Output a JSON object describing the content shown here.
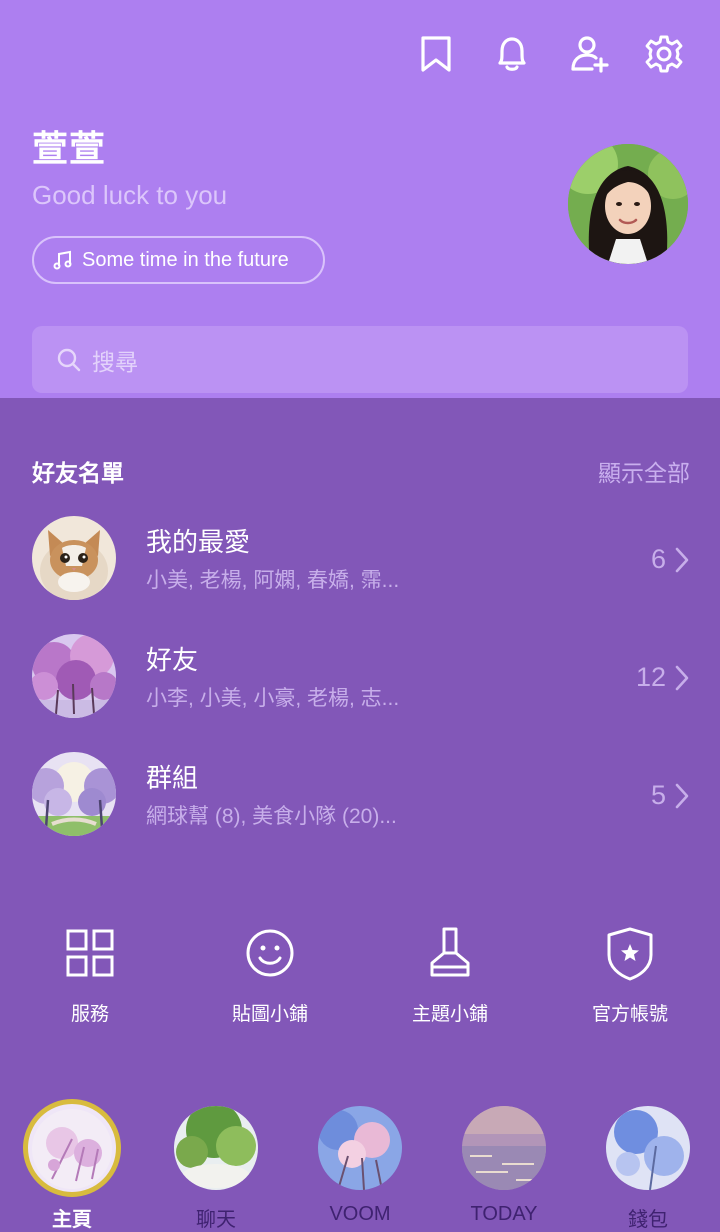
{
  "profile": {
    "name": "萱萱",
    "status": "Good luck to you",
    "music": "Some time in the future"
  },
  "topbar": {
    "icons": [
      "bookmark-icon",
      "bell-icon",
      "add-friend-icon",
      "settings-icon"
    ]
  },
  "search": {
    "placeholder": "搜尋"
  },
  "friends": {
    "title": "好友名單",
    "show_all": "顯示全部",
    "groups": [
      {
        "title": "我的最愛",
        "subtitle": "小美, 老楊, 阿嫻, 春嬌, 霈...",
        "count": "6"
      },
      {
        "title": "好友",
        "subtitle": "小李, 小美, 小豪, 老楊, 志...",
        "count": "12"
      },
      {
        "title": "群組",
        "subtitle": "網球幫 (8), 美食小隊 (20)...",
        "count": "5"
      }
    ]
  },
  "shortcuts": [
    {
      "label": "服務",
      "icon": "grid-icon"
    },
    {
      "label": "貼圖小鋪",
      "icon": "smiley-icon"
    },
    {
      "label": "主題小鋪",
      "icon": "brush-icon"
    },
    {
      "label": "官方帳號",
      "icon": "shield-star-icon"
    }
  ],
  "bottom_nav": [
    {
      "label": "主頁",
      "active": true
    },
    {
      "label": "聊天",
      "active": false
    },
    {
      "label": "VOOM",
      "active": false
    },
    {
      "label": "TODAY",
      "active": false
    },
    {
      "label": "錢包",
      "active": false
    }
  ],
  "colors": {
    "header_bg": "#ad7ff0",
    "body_bg": "#8257b8",
    "search_bg": "#bb92f3",
    "active_ring": "#d8bb3e",
    "nav_label": "#3f2270"
  }
}
